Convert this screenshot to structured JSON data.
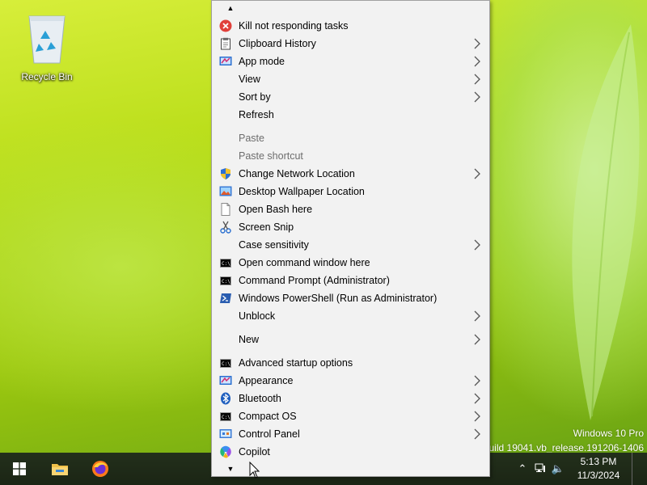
{
  "desktop": {
    "recycle_bin_label": "Recycle Bin",
    "watermark_line1": "Windows 10 Pro",
    "watermark_line2": "Build 19041.vb_release.191206-1406"
  },
  "context_menu": {
    "items": [
      {
        "label": "Kill not responding tasks",
        "icon": "error-icon"
      },
      {
        "label": "Clipboard History",
        "icon": "clipboard-icon",
        "submenu": true
      },
      {
        "label": "App mode",
        "icon": "app-mode-icon",
        "submenu": true
      },
      {
        "label": "View",
        "submenu": true
      },
      {
        "label": "Sort by",
        "submenu": true
      },
      {
        "label": "Refresh"
      },
      {
        "label": "Paste",
        "disabled": true
      },
      {
        "label": "Paste shortcut",
        "disabled": true
      },
      {
        "label": "Change Network Location",
        "icon": "shield-icon",
        "submenu": true
      },
      {
        "label": "Desktop Wallpaper Location",
        "icon": "wallpaper-icon"
      },
      {
        "label": "Open Bash here",
        "icon": "document-icon"
      },
      {
        "label": "Screen Snip",
        "icon": "scissors-icon"
      },
      {
        "label": "Case sensitivity",
        "submenu": true
      },
      {
        "label": "Open command window here",
        "icon": "cmd-icon"
      },
      {
        "label": "Command Prompt (Administrator)",
        "icon": "cmd-icon"
      },
      {
        "label": "Windows PowerShell (Run as Administrator)",
        "icon": "powershell-icon"
      },
      {
        "label": "Unblock",
        "submenu": true
      },
      {
        "label": "New",
        "submenu": true
      },
      {
        "label": "Advanced startup options",
        "icon": "cmd-icon"
      },
      {
        "label": "Appearance",
        "icon": "app-mode-icon",
        "submenu": true
      },
      {
        "label": "Bluetooth",
        "icon": "bluetooth-icon",
        "submenu": true
      },
      {
        "label": "Compact OS",
        "icon": "cmd-icon",
        "submenu": true
      },
      {
        "label": "Control Panel",
        "icon": "control-panel-icon",
        "submenu": true
      },
      {
        "label": "Copilot",
        "icon": "copilot-icon"
      }
    ]
  },
  "taskbar": {
    "time": "5:13 PM",
    "date": "11/3/2024"
  },
  "colors": {
    "menu_bg": "#f2f2f2",
    "disabled_text": "#6d6d6d",
    "taskbar": "#1f2a18"
  }
}
